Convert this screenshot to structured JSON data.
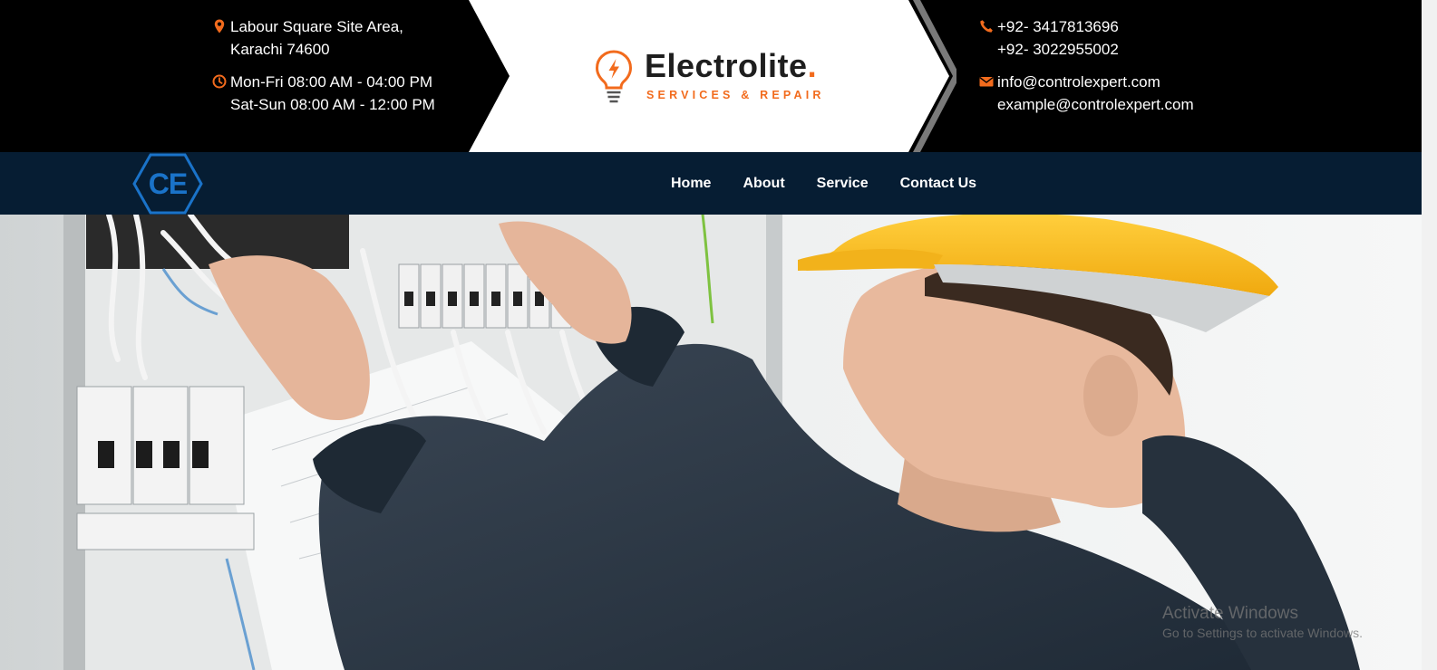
{
  "contact": {
    "address_line1": "Labour Square Site Area,",
    "address_line2": "Karachi 74600",
    "hours_line1": "Mon-Fri 08:00 AM - 04:00 PM",
    "hours_line2": "Sat-Sun 08:00 AM - 12:00 PM",
    "phone1": "+92- 3417813696",
    "phone2": "+92- 3022955002",
    "email1": "info@controlexpert.com",
    "email2": "example@controlexpert.com"
  },
  "brand": {
    "name": "Electrolite",
    "dot": ".",
    "tagline": "SERVICES & REPAIR",
    "accent": "#f26b1d"
  },
  "nav": {
    "logo_text": "CE",
    "items": [
      {
        "label": "Home"
      },
      {
        "label": "About"
      },
      {
        "label": "Service"
      },
      {
        "label": "Contact Us"
      }
    ]
  },
  "hero": {
    "image": "electrician in yellow hard hat working on electrical panel"
  },
  "watermark": {
    "title": "Activate Windows",
    "subtitle": "Go to Settings to activate Windows."
  },
  "colors": {
    "topbar": "#000000",
    "navbar": "#061d33",
    "accent": "#f26b1d",
    "logo_blue": "#1a73c9"
  }
}
